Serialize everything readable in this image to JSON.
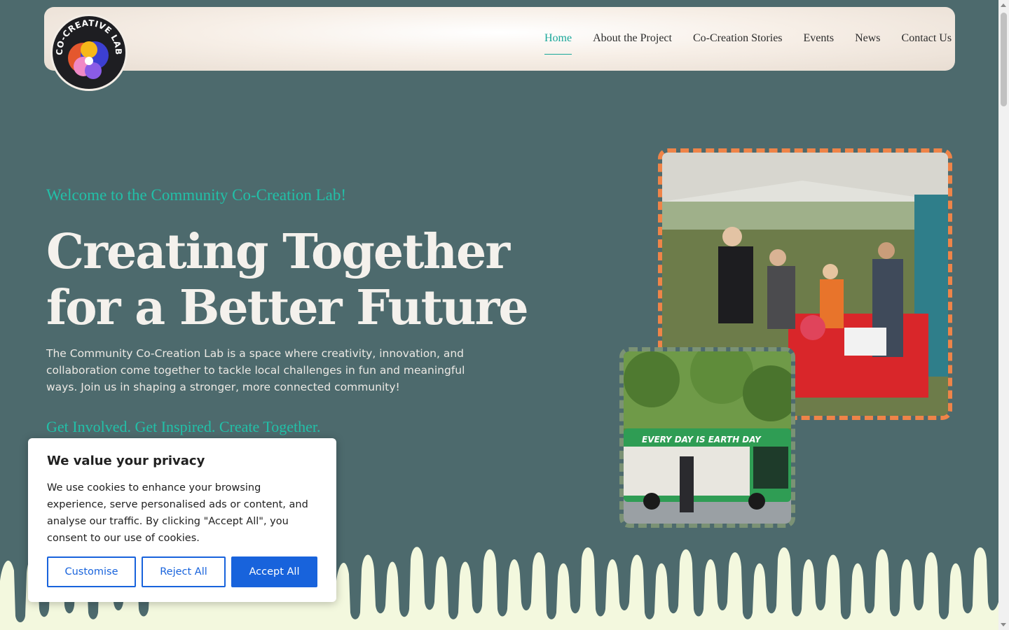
{
  "header": {
    "logo_text": "CO-CREATIVE LAB",
    "nav": [
      {
        "label": "Home",
        "active": true
      },
      {
        "label": "About the Project"
      },
      {
        "label": "Co-Creation Stories"
      },
      {
        "label": "Events"
      },
      {
        "label": "News"
      },
      {
        "label": "Contact Us"
      }
    ]
  },
  "hero": {
    "eyebrow": "Welcome to the Community Co-Creation Lab!",
    "headline_line1": "Creating Together",
    "headline_line2": "for a Better Future",
    "lead": "The Community Co-Creation Lab is a space where creativity, innovation, and collaboration come together to tackle local challenges in fun and meaningful ways. Join us in shaping a stronger, more connected community!",
    "tagline": "Get Involved. Get Inspired. Create Together."
  },
  "photos": {
    "bus_banner": "EVERY DAY IS EARTH DAY"
  },
  "cookie": {
    "title": "We value your privacy",
    "body": "We use cookies to enhance your browsing experience, serve personalised ads or content, and analyse our traffic. By clicking \"Accept All\", you consent to our use of cookies.",
    "customise": "Customise",
    "reject": "Reject All",
    "accept": "Accept All"
  },
  "colors": {
    "background": "#4d6a6d",
    "accent": "#22c0a8",
    "cookie_button": "#1863dc",
    "drip": "#f3f8de"
  }
}
